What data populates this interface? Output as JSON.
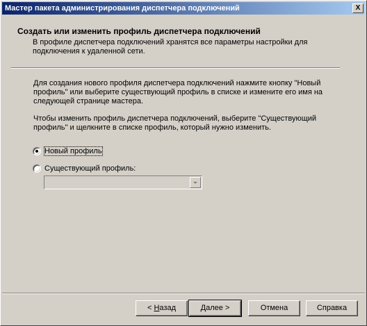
{
  "window": {
    "title": "Мастер пакета администрирования диспетчера подключений",
    "close_label": "X"
  },
  "header": {
    "title": "Создать или изменить профиль диспетчера подключений",
    "subtitle": "В профиле диспетчера подключений хранятся все параметры настройки для подключения к удаленной сети."
  },
  "body": {
    "paragraph1": "Для создания нового профиля диспетчера подключений нажмите кнопку \"Новый профиль\" или выберите существующий профиль в списке и измените его имя на следующей странице мастера.",
    "paragraph2": "Чтобы изменить профиль диспетчера подключений, выберите \"Существующий профиль\" и щелкните в списке профиль, который нужно изменить."
  },
  "options": {
    "new_profile": {
      "label": "Новый профиль",
      "selected": true
    },
    "existing_profile": {
      "label": "Существующий профиль:",
      "selected": false
    },
    "existing_profile_value": ""
  },
  "buttons": {
    "back_prefix": "< ",
    "back_accel": "Н",
    "back_rest": "азад",
    "next_accel": "Д",
    "next_rest": "алее >",
    "cancel": "Отмена",
    "help": "Справка"
  }
}
